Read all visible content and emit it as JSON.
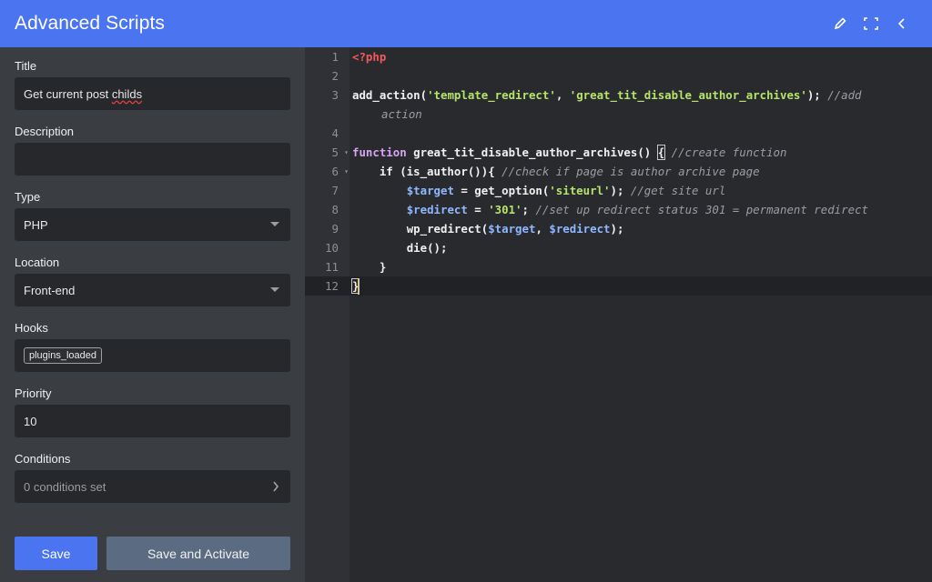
{
  "header": {
    "title": "Advanced Scripts",
    "icons": [
      "pencil-icon",
      "fullscreen-icon",
      "chevron-left-icon"
    ]
  },
  "form": {
    "title_label": "Title",
    "title_value": "Get current post ",
    "title_value_misspelled": "childs",
    "description_label": "Description",
    "description_value": "",
    "type_label": "Type",
    "type_value": "PHP",
    "location_label": "Location",
    "location_value": "Front-end",
    "hooks_label": "Hooks",
    "hooks_tag": "plugins_loaded",
    "priority_label": "Priority",
    "priority_value": "10",
    "conditions_label": "Conditions",
    "conditions_value": "0 conditions set"
  },
  "buttons": {
    "save": "Save",
    "save_activate": "Save and Activate"
  },
  "editor": {
    "line_numbers": [
      "1",
      "2",
      "3",
      "",
      "4",
      "5",
      "6",
      "7",
      "8",
      "9",
      "10",
      "11",
      "12"
    ],
    "php_open": "<?php",
    "l3_fn": "add_action(",
    "l3_str1": "'template_redirect'",
    "l3_sep": ", ",
    "l3_str2": "'great_tit_disable_author_archives'",
    "l3_end": "); ",
    "l3_cmt": "//add",
    "l3_cmt_wrap": "action",
    "l5_kw": "function",
    "l5_name": " great_tit_disable_author_archives() ",
    "l5_brace": "{",
    "l5_cmt": " //create function",
    "l6_code": "    if (is_author()){ ",
    "l6_cmt": "//check if page is author archive page",
    "l7_var": "$target",
    "l7_mid": " = get_option(",
    "l7_str": "'siteurl'",
    "l7_end": "); ",
    "l7_cmt": "//get site url",
    "l8_var": "$redirect",
    "l8_mid": " = ",
    "l8_str": "'301'",
    "l8_end": "; ",
    "l8_cmt": "//set up redirect status 301 = permanent redirect",
    "l9_fn": "wp_redirect(",
    "l9_var1": "$target",
    "l9_sep": ", ",
    "l9_var2": "$redirect",
    "l9_end": ");",
    "l10_code": "die();",
    "l11_code": "}",
    "l12_code": "}"
  }
}
